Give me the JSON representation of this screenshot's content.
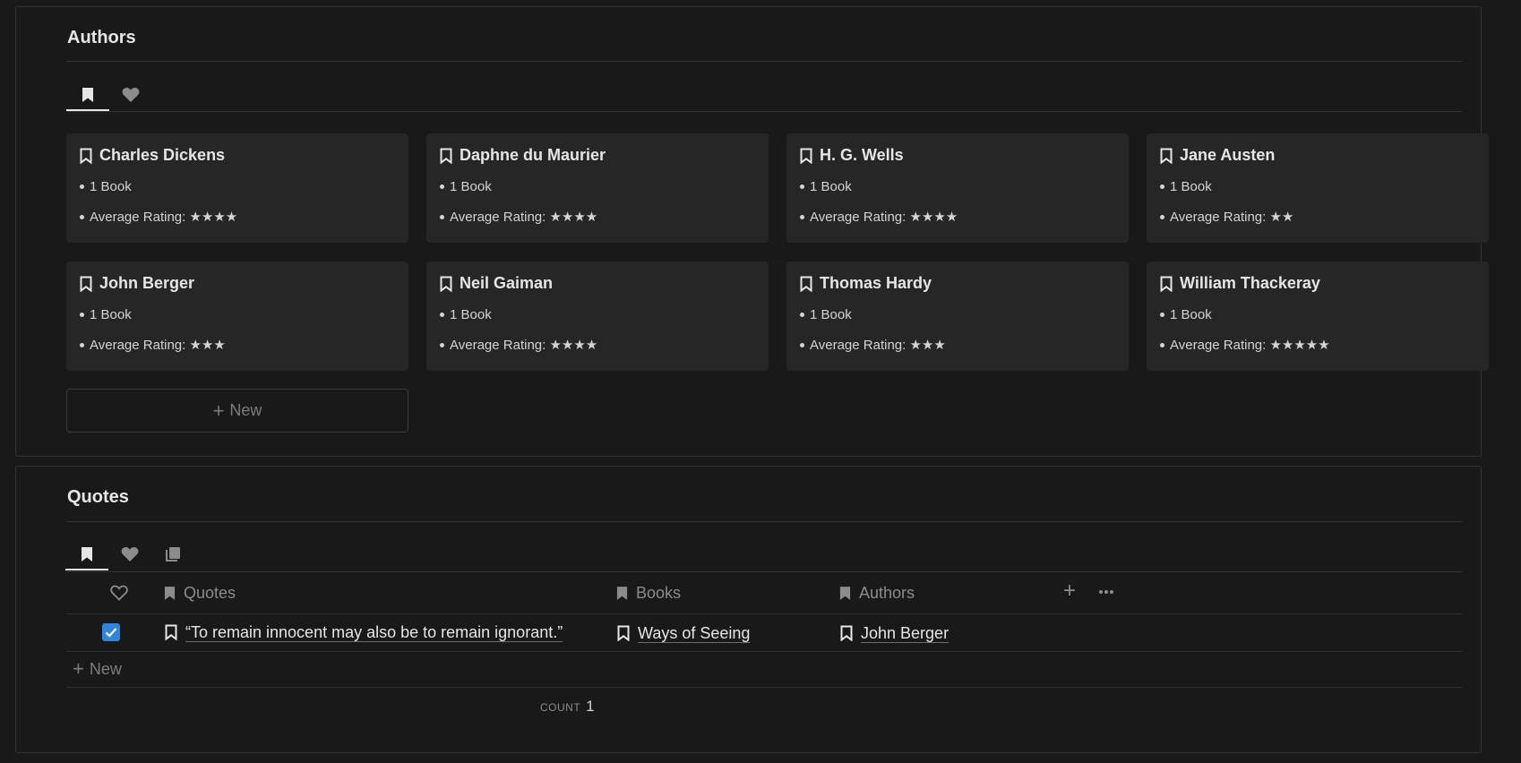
{
  "authors": {
    "title": "Authors",
    "tabs": [
      {
        "icon": "bookmark-icon",
        "active": true
      },
      {
        "icon": "heart-icon",
        "active": false
      }
    ],
    "cards": [
      {
        "name": "Charles Dickens",
        "books": "1 Book",
        "rating": "Average Rating: ★★★★"
      },
      {
        "name": "Daphne du Maurier",
        "books": "1 Book",
        "rating": "Average Rating: ★★★★"
      },
      {
        "name": "H. G. Wells",
        "books": "1 Book",
        "rating": "Average Rating: ★★★★"
      },
      {
        "name": "Jane Austen",
        "books": "1 Book",
        "rating": "Average Rating: ★★"
      },
      {
        "name": "John Berger",
        "books": "1 Book",
        "rating": "Average Rating: ★★★"
      },
      {
        "name": "Neil Gaiman",
        "books": "1 Book",
        "rating": "Average Rating: ★★★★"
      },
      {
        "name": "Thomas Hardy",
        "books": "1 Book",
        "rating": "Average Rating: ★★★"
      },
      {
        "name": "William Thackeray",
        "books": "1 Book",
        "rating": "Average Rating: ★★★★★"
      }
    ],
    "new_label": "New"
  },
  "quotes": {
    "title": "Quotes",
    "tabs": [
      {
        "icon": "bookmark-icon",
        "active": true
      },
      {
        "icon": "heart-icon",
        "active": false
      },
      {
        "icon": "pages-icon",
        "active": false
      }
    ],
    "columns": {
      "favorite": "heart-icon",
      "quotes": "Quotes",
      "books": "Books",
      "authors": "Authors"
    },
    "rows": [
      {
        "favorite": true,
        "quote": "“To remain innocent may also be to remain ignorant.”",
        "book": "Ways of Seeing",
        "author": "John Berger"
      }
    ],
    "new_label": "New",
    "count_label": "COUNT",
    "count_value": "1"
  },
  "colors": {
    "background": "#191919",
    "card": "#262626",
    "checkbox": "#2f84dc"
  }
}
